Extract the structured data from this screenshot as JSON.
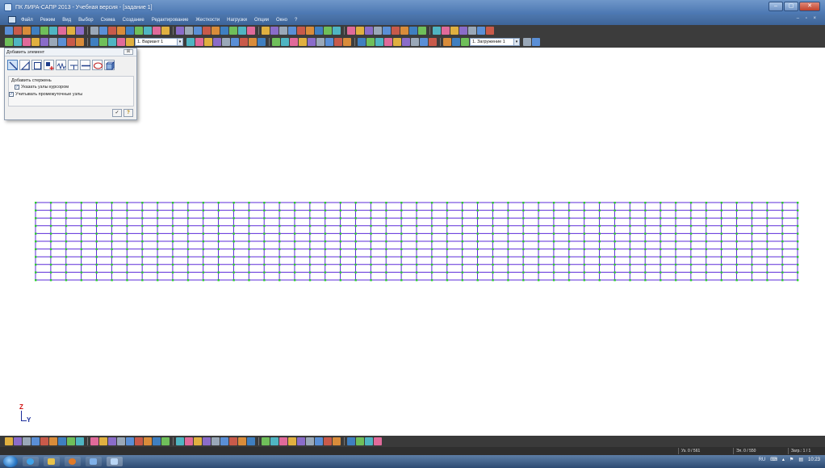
{
  "window": {
    "title": "ПК ЛИРА-САПР 2013 - Учебная версия - [задание 1]",
    "buttons": [
      "–",
      "▢",
      "✕"
    ],
    "mdi_controls": "– ▫ ×"
  },
  "menu": [
    "Файл",
    "Режим",
    "Вид",
    "Выбор",
    "Схема",
    "Создание",
    "Редактирование",
    "Жесткости",
    "Нагрузки",
    "Опции",
    "Окно",
    "?"
  ],
  "toolbar2": {
    "variant_combo": "1. Вариант 1",
    "loadcase_combo": "1. Загружение 1"
  },
  "dialog": {
    "title": "Добавить элемент",
    "close_label": "☒",
    "group_title": "Добавить стержень",
    "checkboxes": [
      {
        "label": "Указать узлы курсором",
        "checked": true
      },
      {
        "label": "Учитывать промежуточные узлы",
        "checked": true
      }
    ],
    "ok_label": "✓",
    "help_label": "?"
  },
  "axis": {
    "z": "Z",
    "y": "Y"
  },
  "status": {
    "nodes": "Уз. 0 / 561",
    "elements": "Эл. 0 / 550",
    "loads": "Загр.: 1 / 1"
  },
  "taskbar": {
    "language": "RU",
    "time": "10:23"
  },
  "icons": {
    "start": "windows-start-icon",
    "browser": "ie-icon",
    "explorer": "folder-icon",
    "media": "media-player-icon",
    "lira": "lira-app-icon"
  },
  "colors": {
    "grid_line": "#5b2bd9",
    "grid_node": "#2ad02a",
    "title_bar": "#4a76b1",
    "axis_z": "#d01010",
    "axis_y": "#1a2c9a"
  },
  "model": {
    "columns": 51,
    "rows": 11
  }
}
